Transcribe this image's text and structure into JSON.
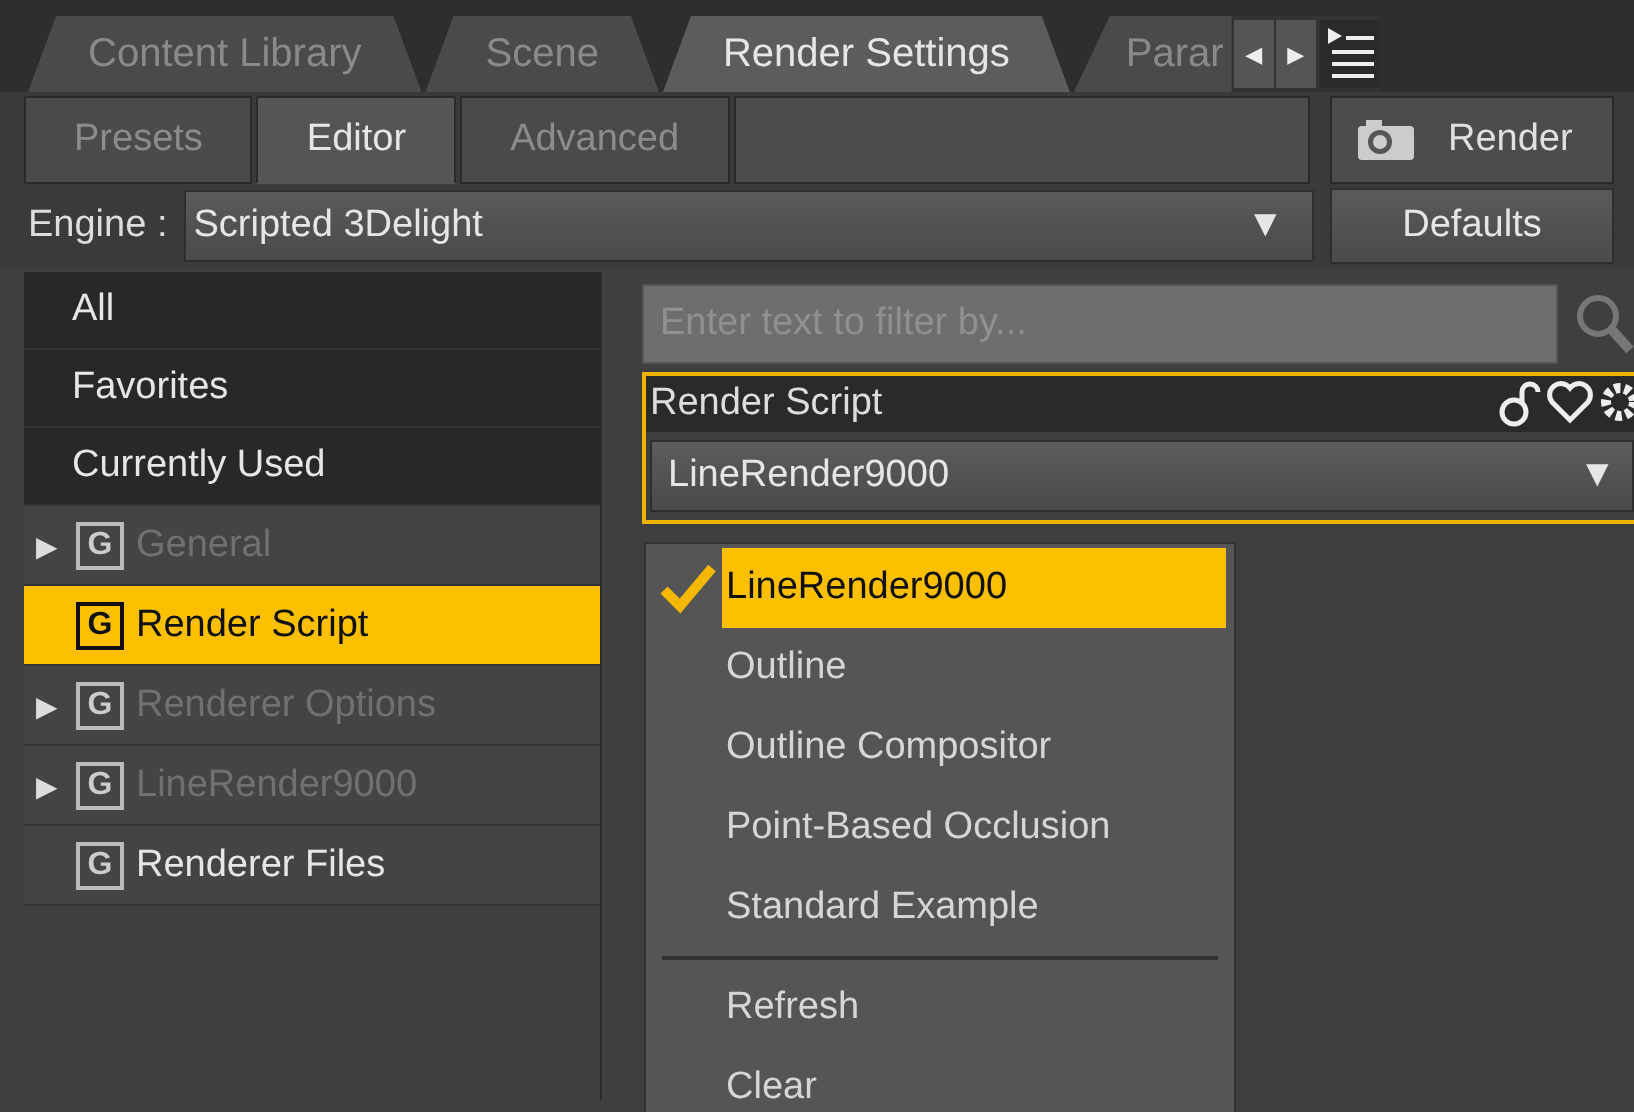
{
  "tabs": [
    {
      "label": "Content Library",
      "selected": false
    },
    {
      "label": "Scene",
      "selected": false
    },
    {
      "label": "Render Settings",
      "selected": true
    },
    {
      "label": "Parar",
      "selected": false
    }
  ],
  "tab_scroll": [
    "◀",
    "▶"
  ],
  "subtabs": [
    {
      "label": "Presets",
      "selected": false
    },
    {
      "label": "Editor",
      "selected": true
    },
    {
      "label": "Advanced",
      "selected": false
    }
  ],
  "render_button": {
    "label": "Render"
  },
  "engine": {
    "label": "Engine :",
    "value": "Scripted 3Delight",
    "arrow": "▼"
  },
  "defaults_button": {
    "label": "Defaults"
  },
  "sidebar": {
    "items": [
      {
        "kind": "filter",
        "label": "All",
        "selected": false
      },
      {
        "kind": "filter",
        "label": "Favorites",
        "selected": false
      },
      {
        "kind": "filter",
        "label": "Currently Used",
        "selected": false
      },
      {
        "kind": "group",
        "label": "General",
        "badge": "G",
        "expander": "▶",
        "disabled": true,
        "selected": false
      },
      {
        "kind": "group",
        "label": "Render Script",
        "badge": "G",
        "disabled": false,
        "selected": true
      },
      {
        "kind": "group",
        "label": "Renderer Options",
        "badge": "G",
        "expander": "▶",
        "disabled": true,
        "selected": false
      },
      {
        "kind": "group",
        "label": "LineRender9000",
        "badge": "G",
        "expander": "▶",
        "disabled": true,
        "selected": false
      },
      {
        "kind": "group",
        "label": "Renderer Files",
        "badge": "G",
        "disabled": false,
        "selected": false
      }
    ]
  },
  "filter": {
    "placeholder": "Enter text to filter by..."
  },
  "property": {
    "label": "Render Script",
    "value": "LineRender9000",
    "arrow": "▼"
  },
  "menu": {
    "items": [
      {
        "kind": "option",
        "label": "LineRender9000",
        "checked": true,
        "selected": true
      },
      {
        "kind": "option",
        "label": "Outline",
        "checked": false,
        "selected": false
      },
      {
        "kind": "option",
        "label": "Outline Compositor",
        "checked": false,
        "selected": false
      },
      {
        "kind": "option",
        "label": "Point-Based Occlusion",
        "checked": false,
        "selected": false
      },
      {
        "kind": "option",
        "label": "Standard Example",
        "checked": false,
        "selected": false
      },
      {
        "kind": "separator"
      },
      {
        "kind": "action",
        "label": "Refresh"
      },
      {
        "kind": "action",
        "label": "Clear"
      }
    ]
  }
}
